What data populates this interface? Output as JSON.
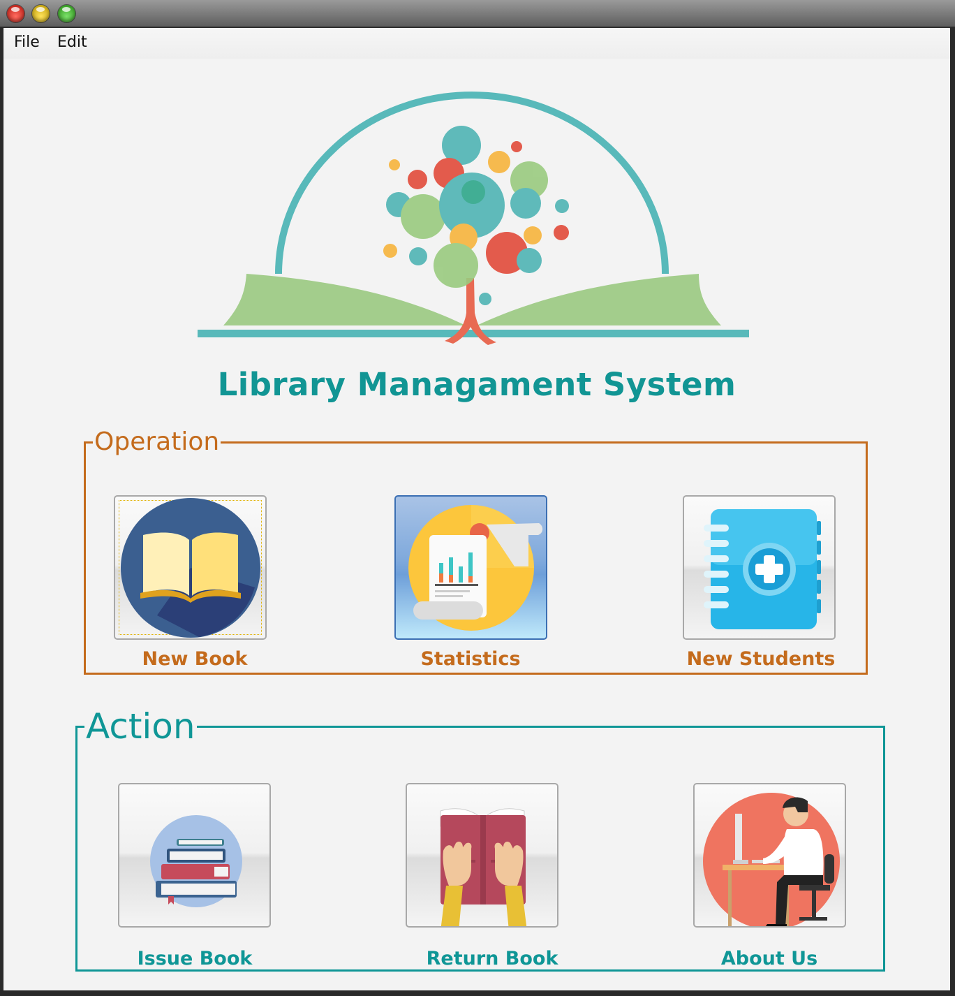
{
  "menu": {
    "file": "File",
    "edit": "Edit"
  },
  "app": {
    "title": "Library Managament System"
  },
  "operation": {
    "legend": "Operation",
    "buttons": [
      {
        "label": "New Book",
        "icon": "open-book-icon"
      },
      {
        "label": "Statistics",
        "icon": "statistics-report-icon"
      },
      {
        "label": "New Students",
        "icon": "address-book-add-icon"
      }
    ]
  },
  "action": {
    "legend": "Action",
    "buttons": [
      {
        "label": "Issue Book",
        "icon": "book-stack-icon"
      },
      {
        "label": "Return Book",
        "icon": "reading-book-icon"
      },
      {
        "label": "About Us",
        "icon": "person-at-computer-icon"
      }
    ]
  },
  "colors": {
    "operation_accent": "#c46b1c",
    "action_accent": "#0f9696",
    "title": "#119594"
  }
}
